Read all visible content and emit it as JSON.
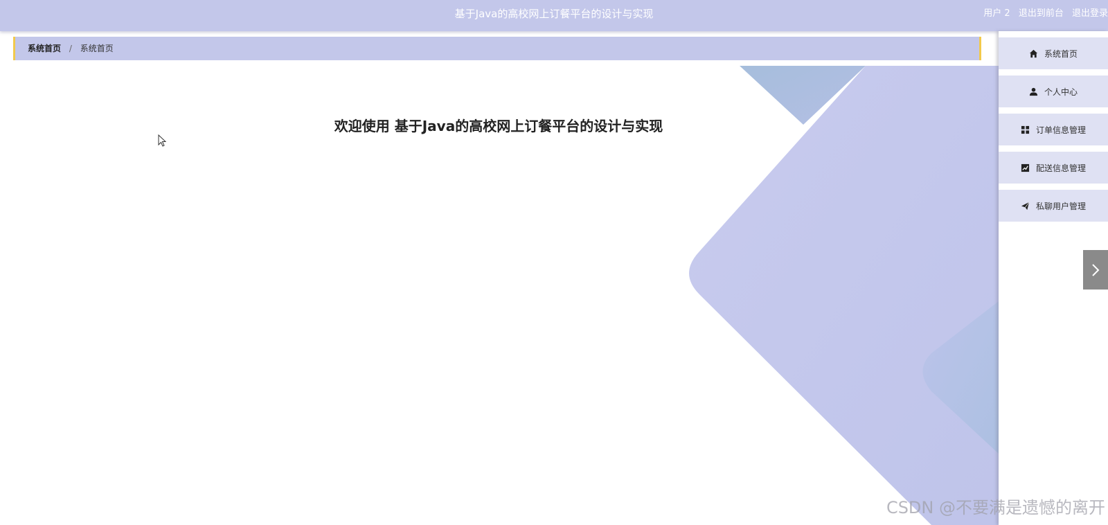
{
  "header": {
    "title": "基于Java的高校网上订餐平台的设计与实现",
    "user": "用户 2",
    "to_frontend": "退出到前台",
    "logout": "退出登录"
  },
  "breadcrumb": {
    "home": "系统首页",
    "separator": "/",
    "current": "系统首页"
  },
  "main": {
    "welcome": "欢迎使用 基于Java的高校网上订餐平台的设计与实现"
  },
  "sidebar": {
    "items": [
      {
        "label": "系统首页",
        "icon": "home-icon"
      },
      {
        "label": "个人中心",
        "icon": "user-icon"
      },
      {
        "label": "订单信息管理",
        "icon": "grid-icon"
      },
      {
        "label": "配送信息管理",
        "icon": "chart-icon"
      },
      {
        "label": "私聊用户管理",
        "icon": "send-icon"
      }
    ]
  },
  "watermark": "CSDN @不要满是遗憾的离开",
  "colors": {
    "accent": "#c3c7ea",
    "breadcrumb_border": "#f2c94c",
    "menu_bg": "#dfe1f3",
    "collapse_bg": "#8a8a8a"
  }
}
